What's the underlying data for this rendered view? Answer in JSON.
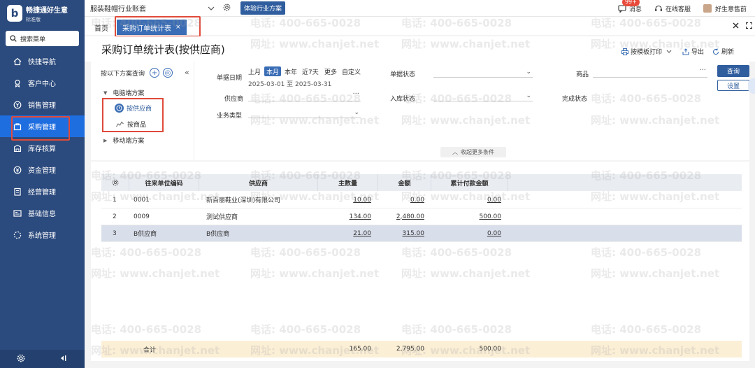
{
  "brand": {
    "name": "畅捷通好生意",
    "edition": "标准版",
    "logo_char": "b"
  },
  "sidebar": {
    "search_label": "搜索菜单",
    "items": [
      {
        "label": "快捷导航",
        "icon": "home-icon"
      },
      {
        "label": "客户中心",
        "icon": "customer-icon"
      },
      {
        "label": "销售管理",
        "icon": "sales-icon"
      },
      {
        "label": "采购管理",
        "icon": "purchase-icon"
      },
      {
        "label": "库存核算",
        "icon": "inventory-icon"
      },
      {
        "label": "资金管理",
        "icon": "money-icon"
      },
      {
        "label": "经营管理",
        "icon": "report-icon"
      },
      {
        "label": "基础信息",
        "icon": "info-icon"
      },
      {
        "label": "系统管理",
        "icon": "system-icon"
      }
    ]
  },
  "topbar": {
    "account": "服装鞋帽行业账套",
    "industry_button": "体验行业方案",
    "messages": "消息",
    "badge": "99+",
    "service": "在线客服",
    "user": "好生意售前"
  },
  "tabs": {
    "home": "首页",
    "active": "采购订单统计表",
    "close": "×"
  },
  "page": {
    "title": "采购订单统计表(按供应商)",
    "print": "按模板打印",
    "export": "导出",
    "refresh": "刷新"
  },
  "scheme": {
    "title": "按以下方案查询",
    "pc": "电脑端方案",
    "by_supplier": "按供应商",
    "by_goods": "按商品",
    "mobile": "移动端方案"
  },
  "filter": {
    "date_label": "单据日期",
    "date_options": [
      "上月",
      "本月",
      "本年",
      "近7天",
      "更多",
      "自定义"
    ],
    "date_range": "2025-03-01 至 2025-03-31",
    "doc_status": "单据状态",
    "goods": "商品",
    "supplier": "供应商",
    "stock_status": "入库状态",
    "complete_status": "完成状态",
    "biz_type": "业务类型",
    "query": "查询",
    "settings": "设置",
    "more": "收起更多条件"
  },
  "grid": {
    "columns": [
      "往来单位编码",
      "供应商",
      "主数量",
      "金额",
      "累计付款金额"
    ],
    "rows": [
      {
        "idx": "1",
        "code": "0001",
        "supplier": "新百丽鞋业(深圳)有限公司",
        "qty": "10.00",
        "amount": "0.00",
        "paid": "0.00"
      },
      {
        "idx": "2",
        "code": "0009",
        "supplier": "测试供应商",
        "qty": "134.00",
        "amount": "2,480.00",
        "paid": "500.00"
      },
      {
        "idx": "3",
        "code": "B供应商",
        "supplier": "B供应商",
        "qty": "21.00",
        "amount": "315.00",
        "paid": "0.00"
      }
    ],
    "total": {
      "label": "合计",
      "qty": "165.00",
      "amount": "2,795.00",
      "paid": "500.00"
    }
  },
  "watermark": {
    "phone": "电话: 400-665-0028",
    "site": "网址: www.chanjet.net"
  }
}
